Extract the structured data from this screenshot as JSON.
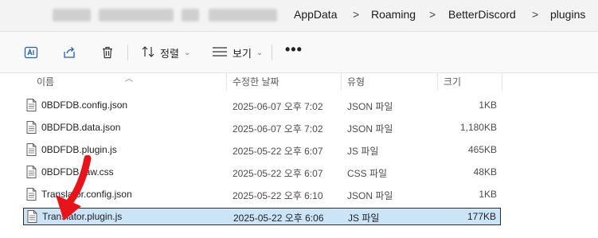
{
  "address_bar": {
    "crumbs": [
      "AppData",
      "Roaming",
      "BetterDiscord",
      "plugins"
    ],
    "separator": ">"
  },
  "toolbar": {
    "icons": [
      "translate-icon",
      "share-icon",
      "delete-icon"
    ],
    "sort_label": "정렬",
    "view_label": "보기",
    "more_label": "•••"
  },
  "columns": {
    "name": "이름",
    "date": "수정한 날짜",
    "type": "유형",
    "size": "크기"
  },
  "files": [
    {
      "name": "0BDFDB.config.json",
      "date": "2025-06-07 오후 7:02",
      "type": "JSON 파일",
      "size": "1KB"
    },
    {
      "name": "0BDFDB.data.json",
      "date": "2025-06-07 오후 7:02",
      "type": "JSON 파일",
      "size": "1,180KB"
    },
    {
      "name": "0BDFDB.plugin.js",
      "date": "2025-05-22 오후 6:07",
      "type": "JS 파일",
      "size": "465KB"
    },
    {
      "name": "0BDFDB.raw.css",
      "date": "2025-05-22 오후 6:07",
      "type": "CSS 파일",
      "size": "48KB"
    },
    {
      "name": "Translator.config.json",
      "date": "2025-05-22 오후 6:10",
      "type": "JSON 파일",
      "size": "1KB"
    },
    {
      "name": "Translator.plugin.js",
      "date": "2025-05-22 오후 6:06",
      "type": "JS 파일",
      "size": "177KB"
    }
  ],
  "selected_index": 5,
  "colors": {
    "selection_bg": "#cce4f7",
    "annotation_arrow": "#e8141a"
  }
}
